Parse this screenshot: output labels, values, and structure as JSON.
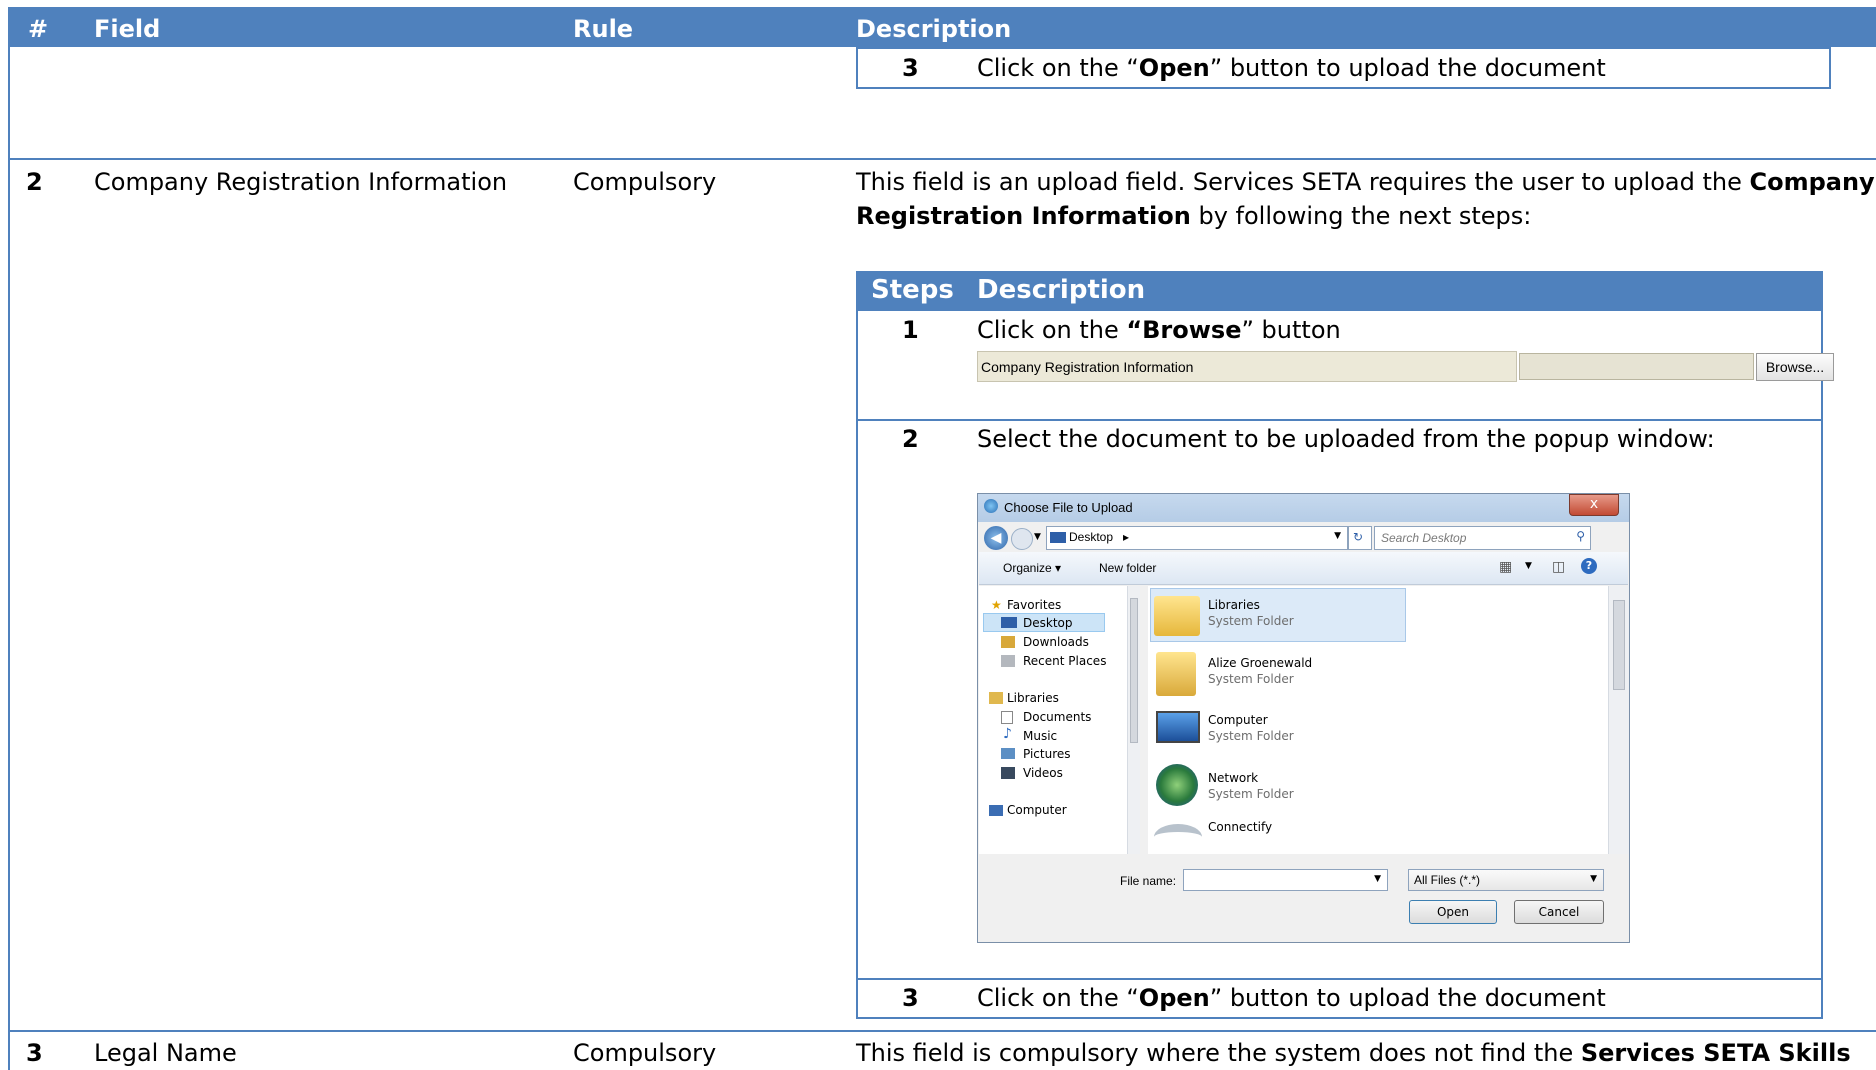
{
  "header": {
    "col_num": "#",
    "col_field": "Field",
    "col_rule": "Rule",
    "col_desc": "Description"
  },
  "top_step": {
    "num": "3",
    "pre": "Click on the “",
    "bold": "Open",
    "post": "” button to upload the document"
  },
  "row2": {
    "num": "2",
    "field": "Company Registration Information",
    "rule": "Compulsory",
    "desc_line1_pre": "This field is an upload field.  Services SETA requires the user to upload the ",
    "desc_line1_bold": "Company",
    "desc_line2_bold": "Registration Information",
    "desc_line2_post": " by following the next steps:"
  },
  "steps_table": {
    "h_steps": "Steps",
    "h_desc": "Description",
    "step1": {
      "num": "1",
      "pre": "Click on the ",
      "bold": "“Browse",
      "post": "” button"
    },
    "browse_bar": {
      "label": "Company Registration Information",
      "button": "Browse..."
    },
    "step2": {
      "num": "2",
      "text": "Select the document to be uploaded from the popup window:"
    },
    "step3": {
      "num": "3",
      "pre": "Click on the “",
      "bold": "Open",
      "post": "” button to upload the document"
    }
  },
  "dialog": {
    "title": "Choose File to Upload",
    "close": "x",
    "address": "Desktop",
    "search_placeholder": "Search Desktop",
    "organize": "Organize ▾",
    "new_folder": "New folder",
    "nav": {
      "favorites": "Favorites",
      "desktop": "Desktop",
      "downloads": "Downloads",
      "recent": "Recent Places",
      "libraries": "Libraries",
      "documents": "Documents",
      "music": "Music",
      "pictures": "Pictures",
      "videos": "Videos",
      "computer": "Computer"
    },
    "files": [
      {
        "name": "Libraries",
        "type": "System Folder"
      },
      {
        "name": "Alize Groenewald",
        "type": "System Folder"
      },
      {
        "name": "Computer",
        "type": "System Folder"
      },
      {
        "name": "Network",
        "type": "System Folder"
      },
      {
        "name": "Connectify",
        "type": ""
      }
    ],
    "filename_label": "File name:",
    "filter": "All Files (*.*)",
    "open": "Open",
    "cancel": "Cancel"
  },
  "row3": {
    "num": "3",
    "field": "Legal Name",
    "rule": "Compulsory",
    "desc_pre": "This field is compulsory where the system does not find the ",
    "desc_bold": "Services SETA Skills"
  },
  "colors": {
    "accent": "#4f81bd"
  }
}
